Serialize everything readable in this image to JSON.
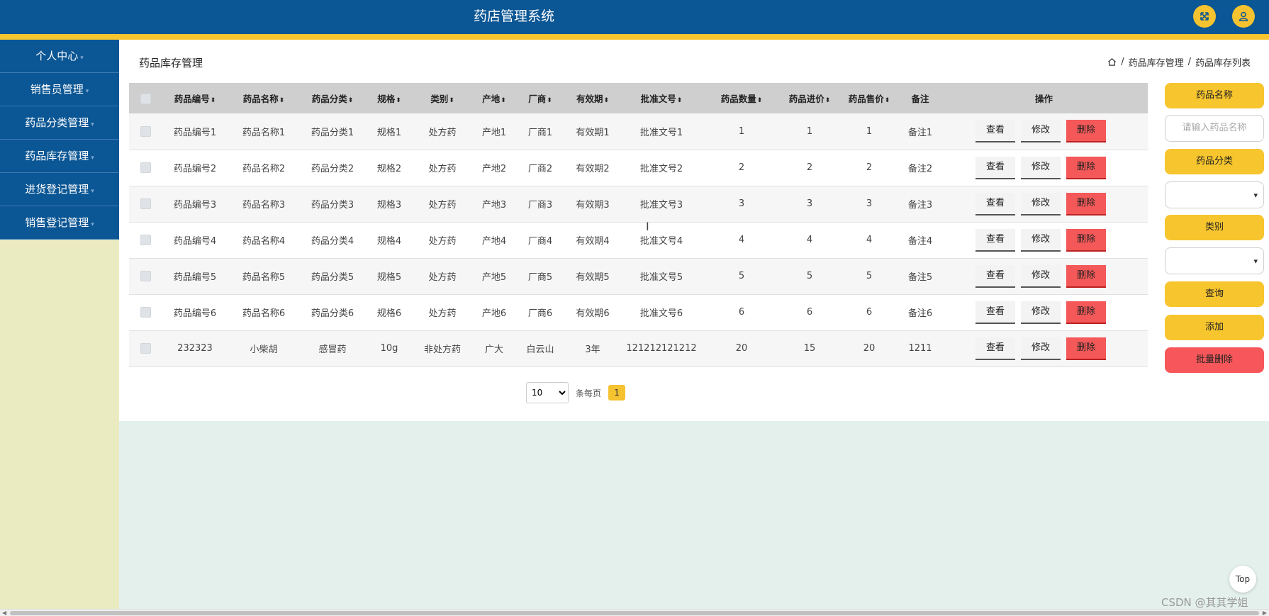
{
  "app": {
    "title": "药店管理系统"
  },
  "sidebar": {
    "items": [
      {
        "label": "个人中心"
      },
      {
        "label": "销售员管理"
      },
      {
        "label": "药品分类管理"
      },
      {
        "label": "药品库存管理"
      },
      {
        "label": "进货登记管理"
      },
      {
        "label": "销售登记管理"
      }
    ]
  },
  "page": {
    "title": "药品库存管理",
    "breadcrumb": [
      "药品库存管理",
      "药品库存列表"
    ]
  },
  "table": {
    "columns": [
      "药品编号",
      "药品名称",
      "药品分类",
      "规格",
      "类别",
      "产地",
      "厂商",
      "有效期",
      "批准文号",
      "药品数量",
      "药品进价",
      "药品售价",
      "备注",
      "操作"
    ],
    "actions": {
      "view": "查看",
      "edit": "修改",
      "delete": "删除"
    },
    "rows": [
      [
        "药品编号1",
        "药品名称1",
        "药品分类1",
        "规格1",
        "处方药",
        "产地1",
        "厂商1",
        "有效期1",
        "批准文号1",
        "1",
        "1",
        "1",
        "备注1"
      ],
      [
        "药品编号2",
        "药品名称2",
        "药品分类2",
        "规格2",
        "处方药",
        "产地2",
        "厂商2",
        "有效期2",
        "批准文号2",
        "2",
        "2",
        "2",
        "备注2"
      ],
      [
        "药品编号3",
        "药品名称3",
        "药品分类3",
        "规格3",
        "处方药",
        "产地3",
        "厂商3",
        "有效期3",
        "批准文号3",
        "3",
        "3",
        "3",
        "备注3"
      ],
      [
        "药品编号4",
        "药品名称4",
        "药品分类4",
        "规格4",
        "处方药",
        "产地4",
        "厂商4",
        "有效期4",
        "批准文号4",
        "4",
        "4",
        "4",
        "备注4"
      ],
      [
        "药品编号5",
        "药品名称5",
        "药品分类5",
        "规格5",
        "处方药",
        "产地5",
        "厂商5",
        "有效期5",
        "批准文号5",
        "5",
        "5",
        "5",
        "备注5"
      ],
      [
        "药品编号6",
        "药品名称6",
        "药品分类6",
        "规格6",
        "处方药",
        "产地6",
        "厂商6",
        "有效期6",
        "批准文号6",
        "6",
        "6",
        "6",
        "备注6"
      ],
      [
        "232323",
        "小柴胡",
        "感冒药",
        "10g",
        "非处方药",
        "广大",
        "白云山",
        "3年",
        "121212121212",
        "20",
        "15",
        "20",
        "1211"
      ]
    ]
  },
  "pagination": {
    "page_size": "10",
    "per_page_label": "条每页",
    "current_page": "1"
  },
  "filters": {
    "name_label": "药品名称",
    "name_placeholder": "请输入药品名称",
    "category_label": "药品分类",
    "type_label": "类别",
    "query_button": "查询",
    "add_button": "添加",
    "batch_delete_button": "批量删除"
  },
  "misc": {
    "top_button": "Top",
    "watermark": "CSDN @其其学姐"
  },
  "colors": {
    "header": "#0b5694",
    "accent": "#f7c52d",
    "danger": "#f45858",
    "sidebar_bg": "#ebebc2"
  }
}
